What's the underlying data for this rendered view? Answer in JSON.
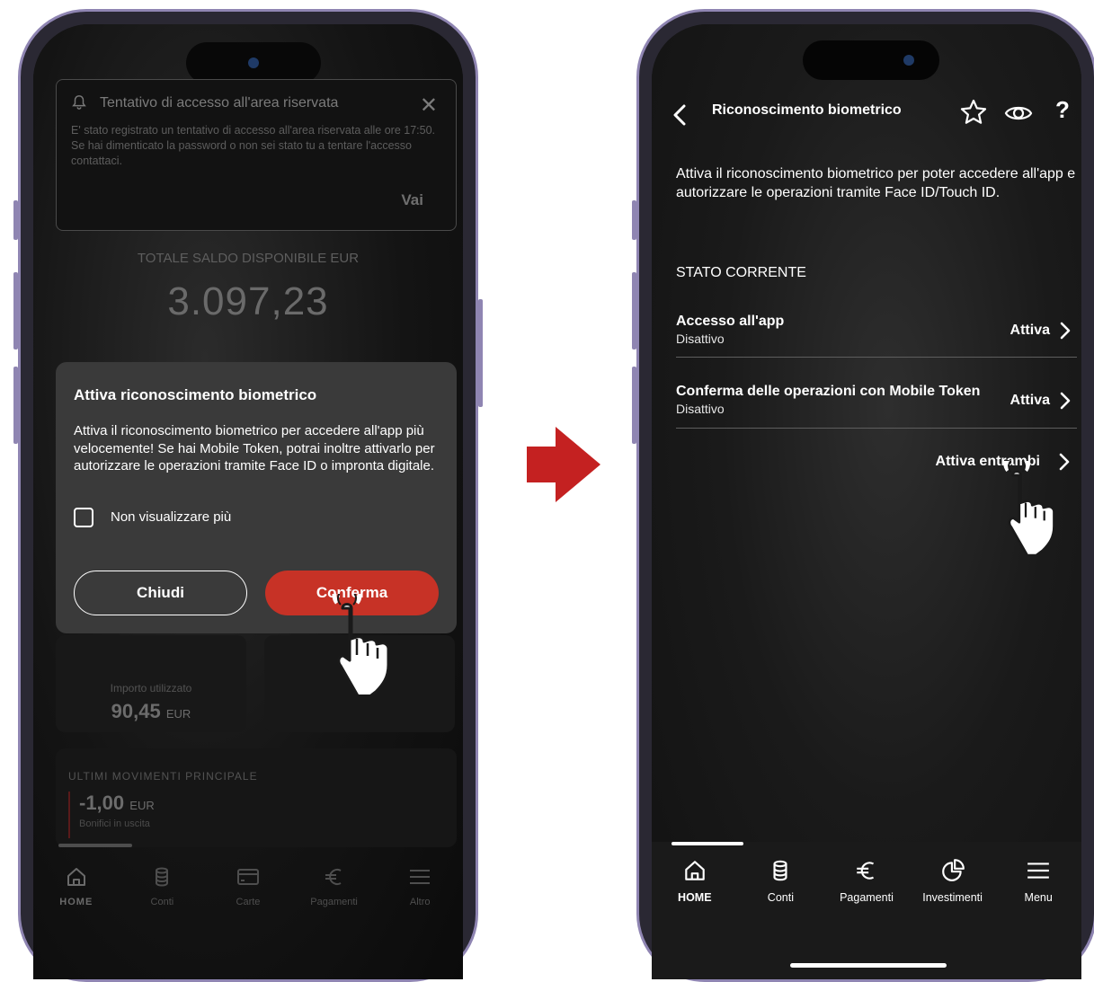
{
  "left_screen": {
    "notification": {
      "title": "Tentativo di accesso all'area riservata",
      "body": "E' stato registrato un tentativo di accesso all'area riservata alle ore 17:50. Se hai dimenticato la password o non sei stato tu a tentare l'accesso contattaci.",
      "action": "Vai"
    },
    "balance_label": "TOTALE SALDO DISPONIBILE EUR",
    "balance_value": "3.097,23",
    "modal": {
      "title": "Attiva riconoscimento biometrico",
      "text": "Attiva il riconoscimento biometrico per accedere all'app più velocemente! Se hai Mobile Token, potrai inoltre attivarlo per autorizzare le operazioni tramite Face ID o impronta digitale.",
      "checkbox_label": "Non visualizzare più",
      "close_label": "Chiudi",
      "confirm_label": "Conferma"
    },
    "card": {
      "label": "Importo utilizzato",
      "value": "90,45",
      "currency": "EUR"
    },
    "movements": {
      "title": "ULTIMI MOVIMENTI PRINCIPALE",
      "value": "-1,00",
      "currency": "EUR",
      "subtitle": "Bonifici in uscita"
    },
    "nav": [
      {
        "label": "HOME",
        "icon": "home-icon"
      },
      {
        "label": "Conti",
        "icon": "database-icon"
      },
      {
        "label": "Carte",
        "icon": "card-icon"
      },
      {
        "label": "Pagamenti",
        "icon": "euro-icon"
      },
      {
        "label": "Altro",
        "icon": "menu-icon"
      }
    ]
  },
  "right_screen": {
    "title": "Riconoscimento biometrico",
    "intro": "Attiva il riconoscimento biometrico per poter accedere all'app e autorizzare le operazioni tramite Face ID/Touch ID.",
    "section": "STATO CORRENTE",
    "rows": [
      {
        "name": "Accesso all'app",
        "status": "Disattivo",
        "action": "Attiva"
      },
      {
        "name": "Conferma delle operazioni con Mobile Token",
        "status": "Disattivo",
        "action": "Attiva"
      }
    ],
    "both_label": "Attiva entrambi",
    "nav": [
      {
        "label": "HOME",
        "icon": "home-icon"
      },
      {
        "label": "Conti",
        "icon": "database-icon"
      },
      {
        "label": "Pagamenti",
        "icon": "euro-icon"
      },
      {
        "label": "Investimenti",
        "icon": "pie-chart-icon"
      },
      {
        "label": "Menu",
        "icon": "menu-icon"
      }
    ]
  },
  "colors": {
    "accent_red": "#c73226",
    "arrow_red": "#c42121",
    "phone_frame": "#8f85b2"
  }
}
